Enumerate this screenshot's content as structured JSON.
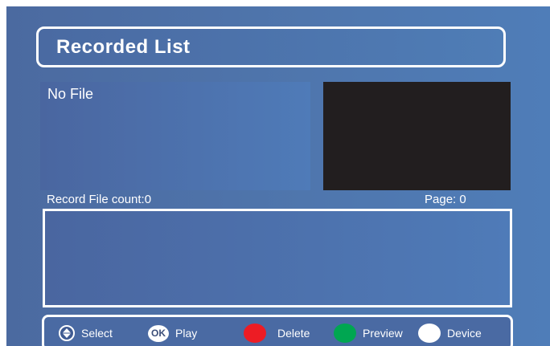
{
  "header": {
    "title": "Recorded List"
  },
  "file_list": {
    "empty_text": "No File"
  },
  "status": {
    "record_count_text": "Record File count:0",
    "page_label": "Page:",
    "page_value": "0"
  },
  "help_bar": {
    "items": [
      {
        "label": "Select",
        "icon": "navigate-updown-icon"
      },
      {
        "label": "Play",
        "icon": "ok-button-icon",
        "icon_text": "OK"
      },
      {
        "label": "Delete",
        "icon": "red-button-icon",
        "color": "#ed1c24"
      },
      {
        "label": "Preview",
        "icon": "green-button-icon",
        "color": "#00a651"
      },
      {
        "label": "Device",
        "icon": "white-button-icon",
        "color": "#ffffff"
      }
    ]
  },
  "colors": {
    "background": "#4f76ad",
    "preview_box": "#221e1f",
    "border": "#ffffff",
    "text": "#ffffff"
  }
}
